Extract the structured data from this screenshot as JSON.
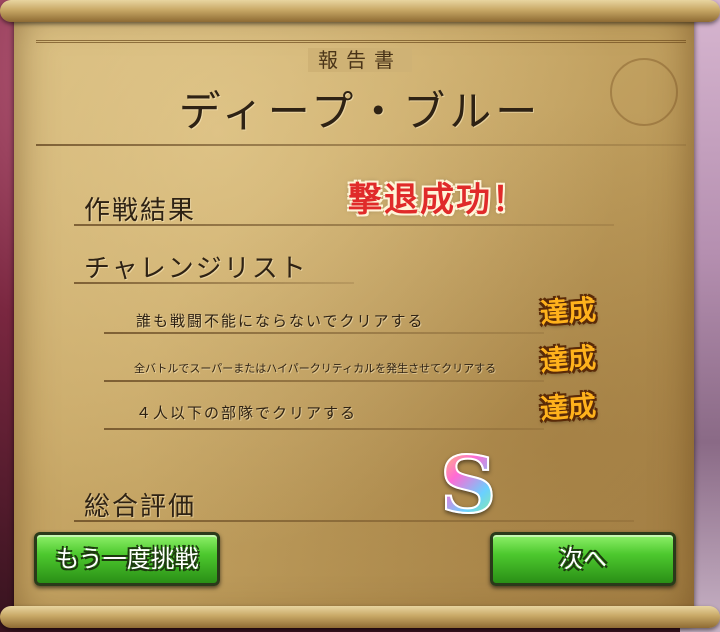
{
  "report": {
    "label": "報告書",
    "title": "ディープ・ブルー"
  },
  "operation": {
    "label": "作戦結果",
    "result": "撃退成功！"
  },
  "challenges": {
    "label": "チャレンジリスト",
    "items": [
      {
        "text": "誰も戦闘不能にならないでクリアする",
        "status": "達成"
      },
      {
        "text": "全バトルでスーパーまたはハイパークリティカルを発生させてクリアする",
        "status": "達成"
      },
      {
        "text": "４人以下の部隊でクリアする",
        "status": "達成"
      }
    ]
  },
  "overall": {
    "label": "総合評価",
    "grade": "S"
  },
  "buttons": {
    "retry": "もう一度挑戦",
    "next": "次へ"
  },
  "colors": {
    "result_red": "#e02a2a",
    "achieved_orange": "#ffb21c",
    "button_green": "#4dc92e",
    "parchment": "#c9a968"
  }
}
